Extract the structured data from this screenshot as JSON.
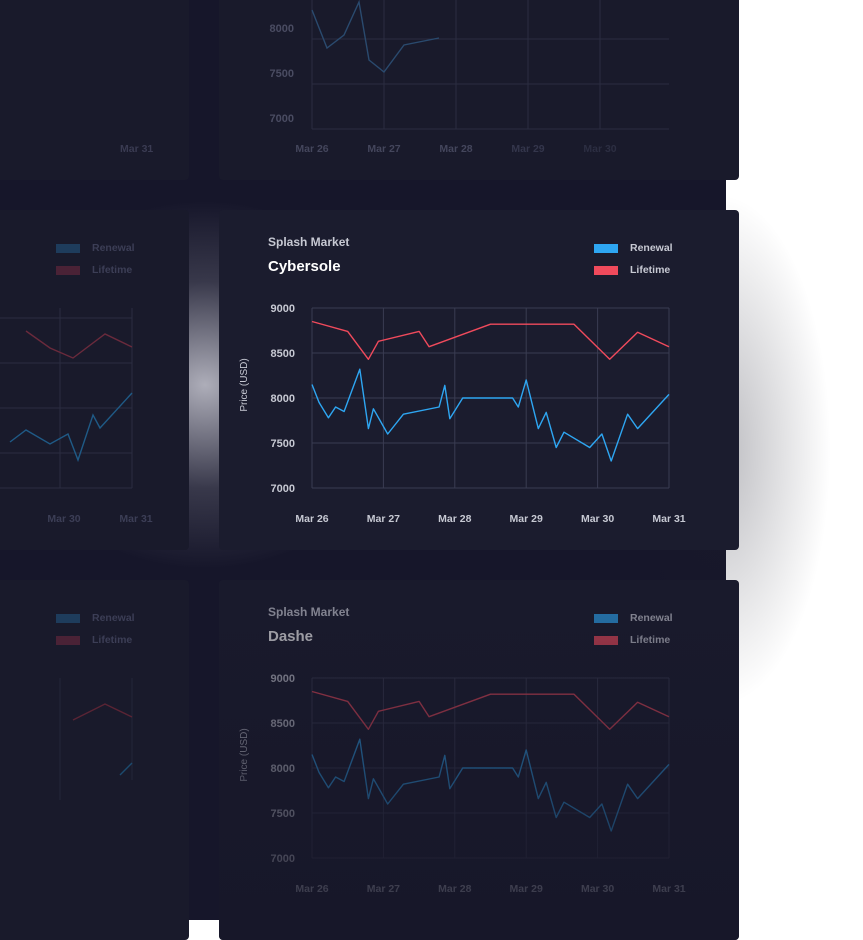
{
  "colors": {
    "renewal": "#2ea6f2",
    "lifetime": "#f04a5c",
    "grid": "#3a3c52",
    "axis_text": "#c7c9d3"
  },
  "main_card": {
    "subtitle": "Splash Market",
    "title": "Cybersole",
    "legend": [
      "Renewal",
      "Lifetime"
    ]
  },
  "bottom_card": {
    "subtitle": "Splash Market",
    "title": "Dashe",
    "legend": [
      "Renewal",
      "Lifetime"
    ]
  },
  "side_cards": {
    "legend": [
      "Renewal",
      "Lifetime"
    ],
    "x_ticks": [
      "Mar 30",
      "Mar 31"
    ],
    "top_x_tick": "Mar 31"
  },
  "top_card": {
    "y_ticks": [
      "8000",
      "7500",
      "7000"
    ],
    "x_ticks": [
      "Mar 26",
      "Mar 27",
      "Mar 28",
      "Mar 29",
      "Mar 30"
    ]
  },
  "chart_data": {
    "type": "line",
    "title": "Cybersole",
    "subtitle": "Splash Market",
    "ylabel": "Price (USD)",
    "ylim": [
      7000,
      9000
    ],
    "yticks": [
      7000,
      7500,
      8000,
      8500,
      9000
    ],
    "xlim": [
      0,
      5
    ],
    "xticks": [
      "Mar 26",
      "Mar 27",
      "Mar 28",
      "Mar 29",
      "Mar 30",
      "Mar 31"
    ],
    "legend_position": "top-right",
    "grid": true,
    "series": [
      {
        "name": "Renewal",
        "color": "#2ea6f2",
        "points": [
          [
            0,
            8150
          ],
          [
            0.1,
            7950
          ],
          [
            0.23,
            7780
          ],
          [
            0.33,
            7900
          ],
          [
            0.45,
            7850
          ],
          [
            0.67,
            8320
          ],
          [
            0.79,
            7660
          ],
          [
            0.86,
            7880
          ],
          [
            1.06,
            7600
          ],
          [
            1.28,
            7820
          ],
          [
            1.78,
            7900
          ],
          [
            1.86,
            8140
          ],
          [
            1.93,
            7770
          ],
          [
            2.11,
            8000
          ],
          [
            2.64,
            8000
          ],
          [
            2.81,
            8000
          ],
          [
            2.89,
            7900
          ],
          [
            3.0,
            8200
          ],
          [
            3.17,
            7660
          ],
          [
            3.28,
            7840
          ],
          [
            3.42,
            7450
          ],
          [
            3.53,
            7620
          ],
          [
            3.89,
            7450
          ],
          [
            4.06,
            7600
          ],
          [
            4.19,
            7300
          ],
          [
            4.42,
            7820
          ],
          [
            4.56,
            7660
          ],
          [
            5.0,
            8040
          ]
        ]
      },
      {
        "name": "Lifetime",
        "color": "#f04a5c",
        "points": [
          [
            0,
            8850
          ],
          [
            0.5,
            8740
          ],
          [
            0.79,
            8430
          ],
          [
            0.93,
            8630
          ],
          [
            1.5,
            8740
          ],
          [
            1.64,
            8570
          ],
          [
            2.5,
            8820
          ],
          [
            3.42,
            8820
          ],
          [
            3.67,
            8820
          ],
          [
            4.17,
            8430
          ],
          [
            4.56,
            8730
          ],
          [
            5.0,
            8570
          ]
        ]
      }
    ]
  }
}
